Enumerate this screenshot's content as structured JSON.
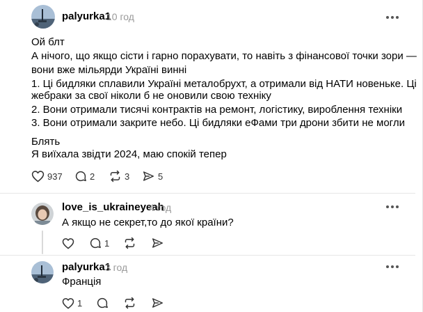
{
  "post": {
    "username": "palyurka1",
    "time": "10 год",
    "lines": [
      "Ой блт",
      "А нічого, що якщо сісти і гарно порахувати, то навіть з фінансової точки зори —",
      "вони вже мільярди Україні винні",
      "1. Ці бидляки сплавили Україні металобрухт, а отримали від НАТИ новеньке. Ці",
      "жебраки за свої ніколи б не оновили свою техніку",
      "2. Вони отримали тисячі контрактів на ремонт, логістику, вироблення техніки",
      "3. Вони отримали закрите небо. Ці бидляки еФами три дрони збити не могли",
      "Блять",
      "Я виїхала звідти 2024, маю спокій тепер"
    ],
    "likes": "937",
    "replies": "2",
    "reposts": "3",
    "shares": "5"
  },
  "reply1": {
    "username": "love_is_ukraineyeah",
    "time": "4 год",
    "text": "А якщо не секрет,то до якої країни?",
    "likes": "",
    "replies": "1"
  },
  "reply2": {
    "username": "palyurka1",
    "time": "3 год",
    "text": "Франція",
    "likes": "1",
    "replies": ""
  },
  "icons": {
    "heart": "heart-icon",
    "comment": "comment-icon",
    "repost": "repost-icon",
    "share": "share-icon",
    "more": "more-icon"
  }
}
